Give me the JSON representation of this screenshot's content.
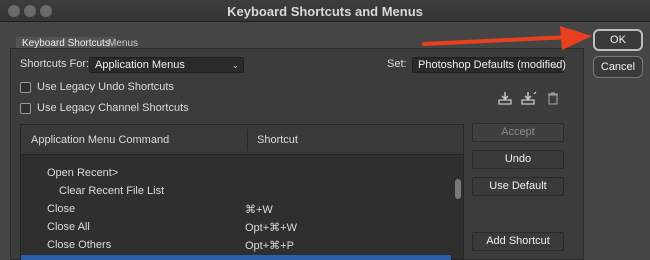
{
  "window": {
    "title": "Keyboard Shortcuts and Menus",
    "background": "#454545"
  },
  "tabs": [
    {
      "label": "Keyboard Shortcuts",
      "active": true
    },
    {
      "label": "Menus",
      "active": false
    }
  ],
  "shortcuts_for": {
    "label": "Shortcuts For:",
    "value": "Application Menus"
  },
  "set": {
    "label": "Set:",
    "value": "Photoshop Defaults (modified)"
  },
  "options": [
    {
      "label": "Use Legacy Undo Shortcuts",
      "checked": false
    },
    {
      "label": "Use Legacy Channel Shortcuts",
      "checked": false
    }
  ],
  "toolbar_icons": [
    "save-set-icon",
    "save-set-as-icon",
    "trash-icon"
  ],
  "table": {
    "columns": [
      "Application Menu Command",
      "Shortcut"
    ],
    "rows": [
      {
        "command": "Open Recent>",
        "shortcut": "",
        "indent": 1
      },
      {
        "command": "Clear Recent File List",
        "shortcut": "",
        "indent": 2
      },
      {
        "command": "Close",
        "shortcut": "⌘+W",
        "indent": 1
      },
      {
        "command": "Close All",
        "shortcut": "Opt+⌘+W",
        "indent": 1
      },
      {
        "command": "Close Others",
        "shortcut": "Opt+⌘+P",
        "indent": 1
      },
      {
        "command": "",
        "shortcut": "",
        "indent": 1,
        "selected": true
      }
    ]
  },
  "side_buttons": [
    {
      "label": "Accept",
      "enabled": false
    },
    {
      "label": "Undo",
      "enabled": true
    },
    {
      "label": "Use Default",
      "enabled": true
    },
    {
      "label": "Add Shortcut",
      "enabled": true
    }
  ],
  "dialog_buttons": {
    "ok": "OK",
    "cancel": "Cancel"
  },
  "annotation": {
    "arrow_color": "#e8401f"
  },
  "colors": {
    "selection": "#2a5fa8",
    "panel": "#3c3c3c"
  }
}
